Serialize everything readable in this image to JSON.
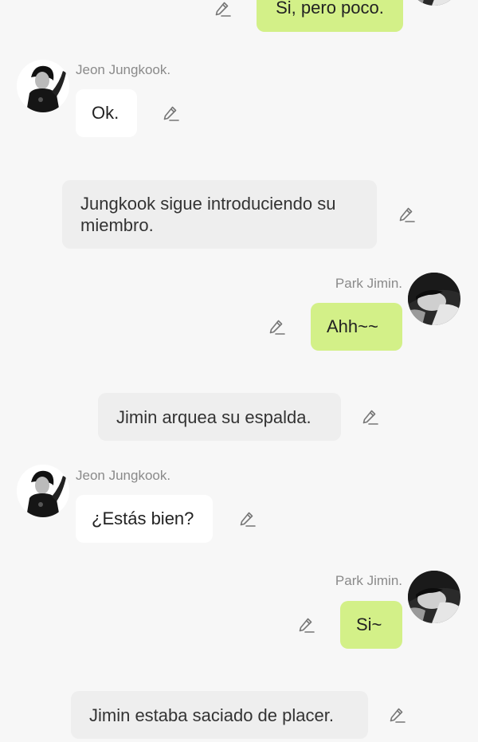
{
  "messages": [
    {
      "type": "right",
      "text": "Si, pero poco."
    },
    {
      "type": "left",
      "name": "Jeon Jungkook.",
      "text": "Ok."
    },
    {
      "type": "narration",
      "text": "Jungkook sigue introduciendo su miembro."
    },
    {
      "type": "right",
      "name": "Park Jimin.",
      "text": "Ahh~~"
    },
    {
      "type": "narration",
      "text": "Jimin arquea su espalda."
    },
    {
      "type": "left",
      "name": "Jeon Jungkook.",
      "text": "¿Estás bien?"
    },
    {
      "type": "right",
      "name": "Park Jimin.",
      "text": "Si~"
    },
    {
      "type": "narration",
      "text": "Jimin estaba saciado de placer."
    }
  ],
  "icons": {
    "edit": "pencil-icon",
    "avatar_left": "jungkook-avatar",
    "avatar_right": "jimin-avatar"
  },
  "colors": {
    "background": "#f7f7f7",
    "sent_bubble": "#d3f088",
    "received_bubble": "#ffffff",
    "narration_bubble": "#eeeeee",
    "name_text": "#8a8a8a"
  }
}
